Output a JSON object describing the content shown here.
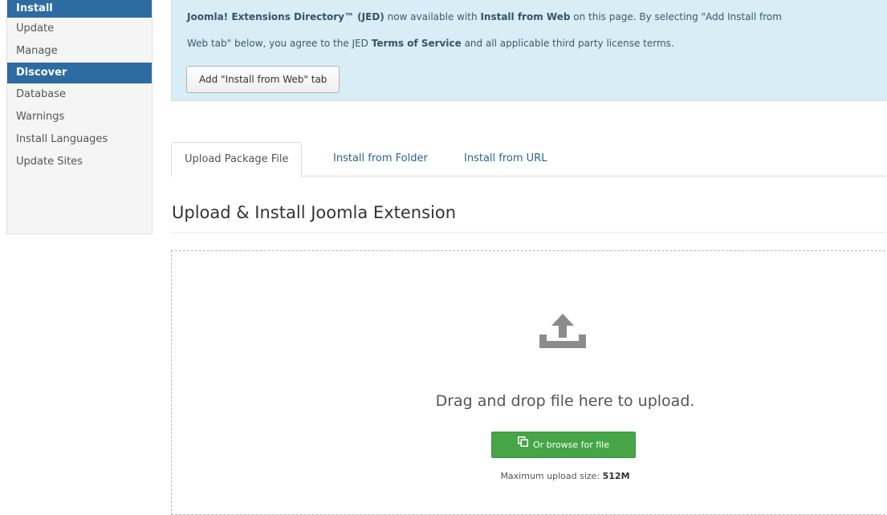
{
  "sidebar": {
    "items": [
      {
        "label": "Install",
        "active": true
      },
      {
        "label": "Update",
        "active": false
      },
      {
        "label": "Manage",
        "active": false
      },
      {
        "label": "Discover",
        "active": true
      },
      {
        "label": "Database",
        "active": false
      },
      {
        "label": "Warnings",
        "active": false
      },
      {
        "label": "Install Languages",
        "active": false
      },
      {
        "label": "Update Sites",
        "active": false
      }
    ]
  },
  "alert": {
    "jed_name": "Joomla! Extensions Directory™ (JED)",
    "text_1": " now available with ",
    "install_from_web": "Install from Web",
    "text_2": " on this page. By selecting \"Add Install from",
    "text_3": "Web tab\" below, you agree to the JED ",
    "terms": "Terms of Service",
    "text_4": " and all applicable third party license terms.",
    "button_label": "Add \"Install from Web\" tab"
  },
  "tabs": [
    {
      "label": "Upload Package File",
      "active": true
    },
    {
      "label": "Install from Folder",
      "active": false
    },
    {
      "label": "Install from URL",
      "active": false
    }
  ],
  "main": {
    "title": "Upload & Install Joomla Extension",
    "drop_text": "Drag and drop file here to upload.",
    "browse_label": "Or browse for file",
    "max_size_label": "Maximum upload size: ",
    "max_size_value": "512M"
  },
  "icons": {
    "upload": "upload-icon",
    "browse": "copy-icon"
  },
  "colors": {
    "sidebar_active": "#2d6ca2",
    "alert_bg": "#d9edf7",
    "link": "#2a6496",
    "browse_button": "#46a546"
  }
}
